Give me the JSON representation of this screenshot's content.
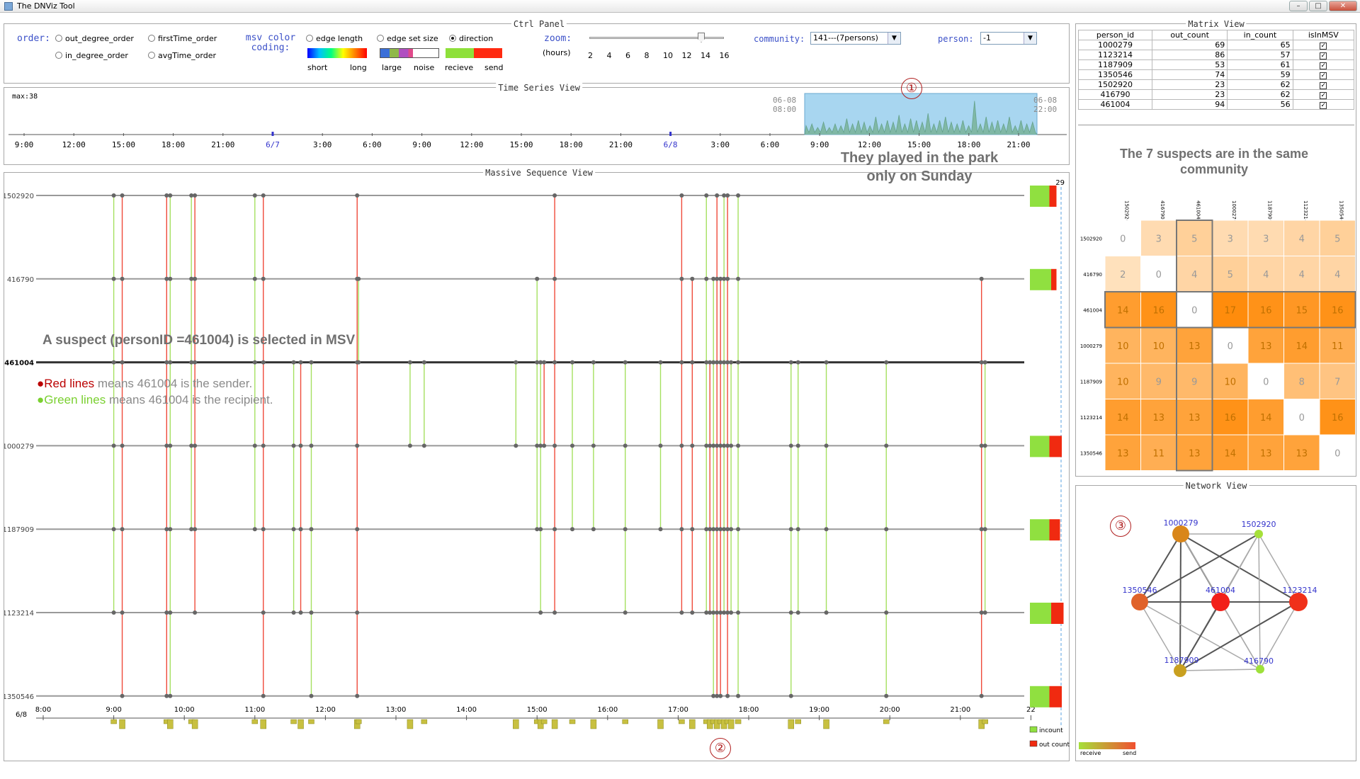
{
  "window": {
    "title": "The DNViz Tool",
    "buttons": [
      "–",
      "□",
      "✕"
    ]
  },
  "ctrl_panel": {
    "title": "Ctrl Panel",
    "order_label": "order:",
    "order_options": [
      {
        "label": "out_degree_order",
        "selected": false
      },
      {
        "label": "firstTime_order",
        "selected": false
      },
      {
        "label": "in_degree_order",
        "selected": false
      },
      {
        "label": "avgTime_order",
        "selected": false
      }
    ],
    "msv_label": "msv color coding:",
    "msv_options": [
      {
        "label": "edge length",
        "selected": false
      },
      {
        "label": "edge set size",
        "selected": false
      },
      {
        "label": "direction",
        "selected": true
      }
    ],
    "edge_length_legend": [
      "short",
      "long"
    ],
    "edge_set_legend": [
      "large",
      "noise"
    ],
    "direction_legend": [
      "recieve",
      "send"
    ],
    "zoom_label": "zoom:",
    "zoom_unit": "(hours)",
    "zoom_ticks": [
      "2",
      "4",
      "6",
      "8",
      "10",
      "12",
      "14",
      "16"
    ],
    "zoom_value": 14,
    "community_label": "community:",
    "community_value": "141---(7persons)",
    "person_label": "person:",
    "person_value": "-1"
  },
  "time_series": {
    "title": "Time Series View",
    "max_label": "max:38",
    "ticks": [
      "9:00",
      "12:00",
      "15:00",
      "18:00",
      "21:00",
      "6/7",
      "3:00",
      "6:00",
      "9:00",
      "12:00",
      "15:00",
      "18:00",
      "21:00",
      "6/8",
      "3:00",
      "6:00",
      "9:00",
      "12:00",
      "15:00",
      "18:00",
      "21:00"
    ],
    "range_start": [
      "06-08",
      "08:00"
    ],
    "range_end": [
      "06-08",
      "22:00"
    ],
    "peaks": [
      0.25,
      0.3,
      0.2,
      0.35,
      0.2,
      0.3,
      0.25,
      0.45,
      0.3,
      0.4,
      0.35,
      0.25,
      0.5,
      0.3,
      0.4,
      0.35,
      0.55,
      0.3,
      0.45,
      0.4,
      0.35,
      0.6,
      0.3,
      0.4,
      0.5,
      0.35,
      0.3,
      0.4,
      0.25,
      0.95,
      0.3,
      0.5,
      0.35,
      0.4,
      0.3,
      0.5,
      0.25,
      0.4,
      0.3,
      0.35
    ]
  },
  "annotations": {
    "park": "They played in the park only on Sunday",
    "suspect": "A suspect (personID =461004) is selected in MSV",
    "red_prefix": "Red lines",
    "red_suffix": " means 461004 is the sender.",
    "green_prefix": "Green lines",
    "green_suffix": " means 461004 is the recipient.",
    "community": "The 7 suspects are in the same community",
    "markers": [
      "①",
      "②",
      "③"
    ]
  },
  "msv": {
    "title": "Massive Sequence View",
    "persons": [
      "1502920",
      "416790",
      "461004",
      "1000279",
      "1187909",
      "1123214",
      "1350546"
    ],
    "selected": "461004",
    "date_label": "6/8",
    "time_ticks": [
      "8:00",
      "9:00",
      "10:00",
      "11:00",
      "12:00",
      "13:00",
      "14:00",
      "15:00",
      "16:00",
      "17:00",
      "18:00",
      "19:00",
      "20:00",
      "21:00",
      "22"
    ],
    "count_max": "29",
    "legend": [
      "incount",
      "out count"
    ],
    "bars": [
      {
        "in": 0.55,
        "out": 0.2
      },
      {
        "in": 0.6,
        "out": 0.15
      },
      {
        "in": 0.0,
        "out": 0.0
      },
      {
        "in": 0.55,
        "out": 0.35
      },
      {
        "in": 0.55,
        "out": 0.3
      },
      {
        "in": 0.6,
        "out": 0.35
      },
      {
        "in": 0.55,
        "out": 0.35
      }
    ],
    "events": [
      {
        "t": 9.0,
        "from": 0,
        "to": 5,
        "dir": "recv"
      },
      {
        "t": 9.12,
        "from": 0,
        "to": 6,
        "dir": "send"
      },
      {
        "t": 9.75,
        "from": 0,
        "to": 6,
        "dir": "send"
      },
      {
        "t": 9.8,
        "from": 0,
        "to": 6,
        "dir": "recv"
      },
      {
        "t": 10.1,
        "from": 0,
        "to": 4,
        "dir": "recv"
      },
      {
        "t": 10.15,
        "from": 0,
        "to": 5,
        "dir": "send"
      },
      {
        "t": 11.0,
        "from": 0,
        "to": 4,
        "dir": "recv"
      },
      {
        "t": 11.12,
        "from": 0,
        "to": 6,
        "dir": "send"
      },
      {
        "t": 11.55,
        "from": 2,
        "to": 5,
        "dir": "recv"
      },
      {
        "t": 11.65,
        "from": 2,
        "to": 5,
        "dir": "send"
      },
      {
        "t": 11.8,
        "from": 2,
        "to": 6,
        "dir": "recv"
      },
      {
        "t": 12.45,
        "from": 0,
        "to": 6,
        "dir": "send"
      },
      {
        "t": 12.47,
        "from": 1,
        "to": 2,
        "dir": "recv"
      },
      {
        "t": 13.2,
        "from": 2,
        "to": 3,
        "dir": "recv"
      },
      {
        "t": 13.4,
        "from": 2,
        "to": 3,
        "dir": "recv"
      },
      {
        "t": 14.7,
        "from": 2,
        "to": 3,
        "dir": "recv"
      },
      {
        "t": 15.0,
        "from": 1,
        "to": 4,
        "dir": "recv"
      },
      {
        "t": 15.05,
        "from": 2,
        "to": 5,
        "dir": "recv"
      },
      {
        "t": 15.1,
        "from": 2,
        "to": 3,
        "dir": "send"
      },
      {
        "t": 15.25,
        "from": 0,
        "to": 5,
        "dir": "send"
      },
      {
        "t": 15.5,
        "from": 2,
        "to": 4,
        "dir": "recv"
      },
      {
        "t": 15.8,
        "from": 2,
        "to": 4,
        "dir": "recv"
      },
      {
        "t": 16.25,
        "from": 2,
        "to": 5,
        "dir": "recv"
      },
      {
        "t": 16.75,
        "from": 2,
        "to": 4,
        "dir": "recv"
      },
      {
        "t": 17.05,
        "from": 0,
        "to": 5,
        "dir": "send"
      },
      {
        "t": 17.2,
        "from": 1,
        "to": 5,
        "dir": "send"
      },
      {
        "t": 17.4,
        "from": 0,
        "to": 5,
        "dir": "recv"
      },
      {
        "t": 17.45,
        "from": 2,
        "to": 5,
        "dir": "send"
      },
      {
        "t": 17.5,
        "from": 1,
        "to": 6,
        "dir": "recv"
      },
      {
        "t": 17.55,
        "from": 0,
        "to": 6,
        "dir": "send"
      },
      {
        "t": 17.6,
        "from": 1,
        "to": 6,
        "dir": "send"
      },
      {
        "t": 17.65,
        "from": 0,
        "to": 5,
        "dir": "recv"
      },
      {
        "t": 17.7,
        "from": 0,
        "to": 6,
        "dir": "send"
      },
      {
        "t": 17.75,
        "from": 2,
        "to": 5,
        "dir": "recv"
      },
      {
        "t": 17.85,
        "from": 0,
        "to": 6,
        "dir": "recv"
      },
      {
        "t": 18.6,
        "from": 2,
        "to": 6,
        "dir": "recv"
      },
      {
        "t": 18.7,
        "from": 2,
        "to": 5,
        "dir": "recv"
      },
      {
        "t": 19.1,
        "from": 2,
        "to": 5,
        "dir": "recv"
      },
      {
        "t": 19.95,
        "from": 2,
        "to": 6,
        "dir": "recv"
      },
      {
        "t": 21.3,
        "from": 1,
        "to": 6,
        "dir": "send"
      },
      {
        "t": 21.35,
        "from": 2,
        "to": 5,
        "dir": "recv"
      }
    ]
  },
  "matrix_view": {
    "title": "Matrix View",
    "columns": [
      "person_id",
      "out_count",
      "in_count",
      "isInMSV"
    ],
    "rows": [
      [
        "1000279",
        "69",
        "65",
        "✓"
      ],
      [
        "1123214",
        "86",
        "57",
        "✓"
      ],
      [
        "1187909",
        "53",
        "61",
        "✓"
      ],
      [
        "1350546",
        "74",
        "59",
        "✓"
      ],
      [
        "1502920",
        "23",
        "62",
        "✓"
      ],
      [
        "416790",
        "23",
        "62",
        "✓"
      ],
      [
        "461004",
        "94",
        "56",
        "✓"
      ]
    ],
    "heat_labels": [
      "1502920",
      "416790",
      "461004",
      "1000279",
      "1187909",
      "1123214",
      "1350546"
    ],
    "heat_values": [
      [
        0,
        3,
        5,
        3,
        3,
        4,
        5
      ],
      [
        2,
        0,
        4,
        5,
        4,
        4,
        4
      ],
      [
        14,
        16,
        0,
        17,
        16,
        15,
        16
      ],
      [
        10,
        10,
        13,
        0,
        13,
        14,
        11
      ],
      [
        10,
        9,
        9,
        10,
        0,
        8,
        7
      ],
      [
        14,
        13,
        13,
        16,
        14,
        0,
        16
      ],
      [
        13,
        11,
        13,
        14,
        13,
        13,
        0
      ]
    ]
  },
  "network_view": {
    "title": "Network View",
    "legend": [
      "receive",
      "send"
    ],
    "nodes": [
      {
        "id": "1000279",
        "color": "#d9861a",
        "r": 12
      },
      {
        "id": "1502920",
        "color": "#a6e03a",
        "r": 6
      },
      {
        "id": "1350546",
        "color": "#e0622a",
        "r": 12
      },
      {
        "id": "461004",
        "color": "#f2201a",
        "r": 13
      },
      {
        "id": "1123214",
        "color": "#f0301a",
        "r": 13
      },
      {
        "id": "1187909",
        "color": "#c9a020",
        "r": 9
      },
      {
        "id": "416790",
        "color": "#9ee03a",
        "r": 6
      }
    ]
  }
}
